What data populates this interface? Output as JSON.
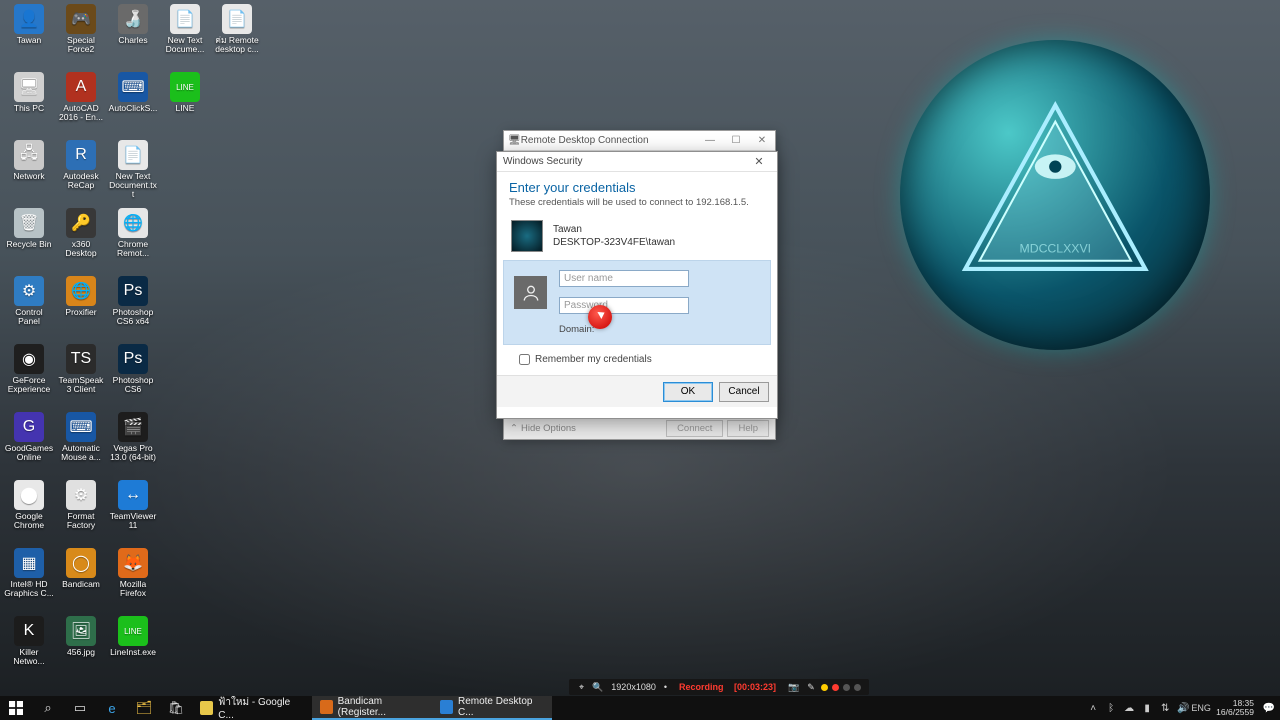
{
  "desktop_icons": [
    {
      "label": "Tawan",
      "glyph": "👤",
      "bg": "#2677c9"
    },
    {
      "label": "Special Force2",
      "glyph": "🎮",
      "bg": "#6b4a1a"
    },
    {
      "label": "Charles",
      "glyph": "🍶",
      "bg": "#6a6a6a"
    },
    {
      "label": "New Text Docume...",
      "glyph": "📄",
      "bg": "#e8e8e8"
    },
    {
      "label": "ค่ม Remote desktop c...",
      "glyph": "📄",
      "bg": "#e8e8e8"
    },
    {
      "label": "This PC",
      "glyph": "🖥",
      "bg": "#d0d0d0"
    },
    {
      "label": "AutoCAD 2016 - En...",
      "glyph": "A",
      "bg": "#b1311f"
    },
    {
      "label": "AutoClickS...",
      "glyph": "⌨",
      "bg": "#1857a4"
    },
    {
      "label": "LINE",
      "glyph": "LINE",
      "bg": "#1bbf1b"
    },
    {
      "label": "",
      "glyph": "",
      "bg": "",
      "empty": true
    },
    {
      "label": "Network",
      "glyph": "🖧",
      "bg": "#c9c9c9"
    },
    {
      "label": "Autodesk ReCap",
      "glyph": "R",
      "bg": "#2d6fb5"
    },
    {
      "label": "New Text Document.txt",
      "glyph": "📄",
      "bg": "#e8e8e8"
    },
    {
      "label": "",
      "glyph": "",
      "bg": "",
      "empty": true
    },
    {
      "label": "",
      "glyph": "",
      "bg": "",
      "empty": true
    },
    {
      "label": "Recycle Bin",
      "glyph": "🗑",
      "bg": "#b7c2c6"
    },
    {
      "label": "x360 Desktop",
      "glyph": "🔑",
      "bg": "#383838"
    },
    {
      "label": "Chrome Remot...",
      "glyph": "🌐",
      "bg": "#e6e6e6"
    },
    {
      "label": "",
      "glyph": "",
      "bg": "",
      "empty": true
    },
    {
      "label": "",
      "glyph": "",
      "bg": "",
      "empty": true
    },
    {
      "label": "Control Panel",
      "glyph": "⚙",
      "bg": "#2f7cc2"
    },
    {
      "label": "Proxifier",
      "glyph": "🌐",
      "bg": "#d8851a"
    },
    {
      "label": "Photoshop CS6 x64",
      "glyph": "Ps",
      "bg": "#0a2a45"
    },
    {
      "label": "",
      "glyph": "",
      "bg": "",
      "empty": true
    },
    {
      "label": "",
      "glyph": "",
      "bg": "",
      "empty": true
    },
    {
      "label": "GeForce Experience",
      "glyph": "◉",
      "bg": "#1f1f1f"
    },
    {
      "label": "TeamSpeak 3 Client",
      "glyph": "TS",
      "bg": "#2b2b2b"
    },
    {
      "label": "Photoshop CS6",
      "glyph": "Ps",
      "bg": "#0a2a45"
    },
    {
      "label": "",
      "glyph": "",
      "bg": "",
      "empty": true
    },
    {
      "label": "",
      "glyph": "",
      "bg": "",
      "empty": true
    },
    {
      "label": "GoodGames Online",
      "glyph": "G",
      "bg": "#4434b0"
    },
    {
      "label": "Automatic Mouse a...",
      "glyph": "⌨",
      "bg": "#1857a4"
    },
    {
      "label": "Vegas Pro 13.0 (64-bit)",
      "glyph": "🎬",
      "bg": "#1d1d1d"
    },
    {
      "label": "",
      "glyph": "",
      "bg": "",
      "empty": true
    },
    {
      "label": "",
      "glyph": "",
      "bg": "",
      "empty": true
    },
    {
      "label": "Google Chrome",
      "glyph": "⬤",
      "bg": "#e8e8e8"
    },
    {
      "label": "Format Factory",
      "glyph": "⚙",
      "bg": "#e0e0e0"
    },
    {
      "label": "TeamViewer 11",
      "glyph": "↔",
      "bg": "#1e7bd6"
    },
    {
      "label": "",
      "glyph": "",
      "bg": "",
      "empty": true
    },
    {
      "label": "",
      "glyph": "",
      "bg": "",
      "empty": true
    },
    {
      "label": "Intel® HD Graphics C...",
      "glyph": "▦",
      "bg": "#1e5fa8"
    },
    {
      "label": "Bandicam",
      "glyph": "◯",
      "bg": "#d88a1a"
    },
    {
      "label": "Mozilla Firefox",
      "glyph": "🦊",
      "bg": "#e06a1a"
    },
    {
      "label": "",
      "glyph": "",
      "bg": "",
      "empty": true
    },
    {
      "label": "",
      "glyph": "",
      "bg": "",
      "empty": true
    },
    {
      "label": "Killer Netwo...",
      "glyph": "K",
      "bg": "#1c1c1c"
    },
    {
      "label": "456.jpg",
      "glyph": "🖼",
      "bg": "#2e6e4a"
    },
    {
      "label": "LineInst.exe",
      "glyph": "LINE",
      "bg": "#1bbf1b"
    },
    {
      "label": "",
      "glyph": "",
      "bg": "",
      "empty": true
    },
    {
      "label": "",
      "glyph": "",
      "bg": "",
      "empty": true
    }
  ],
  "rdc": {
    "title": "Remote Desktop Connection",
    "hide": "Hide Options",
    "connect": "Connect",
    "help": "Help"
  },
  "sec": {
    "bar_title": "Windows Security",
    "heading": "Enter your credentials",
    "sub": "These credentials will be used to connect to 192.168.1.5.",
    "acct_name": "Tawan",
    "acct_domain": "DESKTOP-323V4FE\\tawan",
    "ph_user": "User name",
    "ph_pass": "Password",
    "domain_label": "Domain:",
    "remember": "Remember my credentials",
    "ok": "OK",
    "cancel": "Cancel"
  },
  "bandicam": {
    "res": "1920x1080",
    "status": "Recording",
    "time": "[00:03:23]"
  },
  "taskbar": {
    "tasks": [
      {
        "label": "ฟ้าใหม่ - Google C...",
        "color": "#e8c84a"
      },
      {
        "label": "Bandicam (Register...",
        "color": "#d86a1a"
      },
      {
        "label": "Remote Desktop C...",
        "color": "#2a7fd4"
      }
    ],
    "lang": "ENG",
    "time": "18:35",
    "date": "16/6/2559"
  }
}
